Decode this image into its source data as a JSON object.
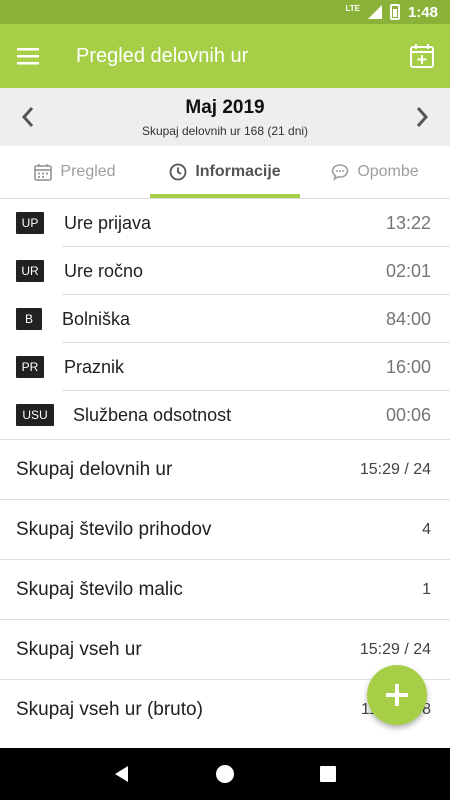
{
  "status_bar": {
    "network": "LTE",
    "time": "1:48"
  },
  "app_bar": {
    "title": "Pregled delovnih ur"
  },
  "month_nav": {
    "title": "Maj 2019",
    "subtitle": "Skupaj delovnih ur 168 (21 dni)"
  },
  "tabs": [
    {
      "label": "Pregled",
      "icon": "calendar-icon",
      "active": false
    },
    {
      "label": "Informacije",
      "icon": "clock-icon",
      "active": true
    },
    {
      "label": "Opombe",
      "icon": "comment-icon",
      "active": false
    }
  ],
  "codes": [
    {
      "code": "UP",
      "label": "Ure prijava",
      "value": "13:22"
    },
    {
      "code": "UR",
      "label": "Ure ročno",
      "value": "02:01"
    },
    {
      "code": "B",
      "label": "Bolniška",
      "value": "84:00"
    },
    {
      "code": "PR",
      "label": "Praznik",
      "value": "16:00"
    },
    {
      "code": "USU",
      "label": "Službena odsotnost",
      "value": "00:06"
    }
  ],
  "summary": [
    {
      "label": "Skupaj delovnih ur",
      "value": "15:29 / 24"
    },
    {
      "label": "Skupaj število prihodov",
      "value": "4"
    },
    {
      "label": "Skupaj število malic",
      "value": "1"
    },
    {
      "label": "Skupaj vseh ur",
      "value": "15:29 / 24"
    },
    {
      "label": "Skupaj vseh ur (bruto)",
      "value": "115:29 / 8"
    }
  ],
  "colors": {
    "status_bar": "#8bb238",
    "app_bar": "#a6cf47",
    "accent": "#a6cf47"
  }
}
